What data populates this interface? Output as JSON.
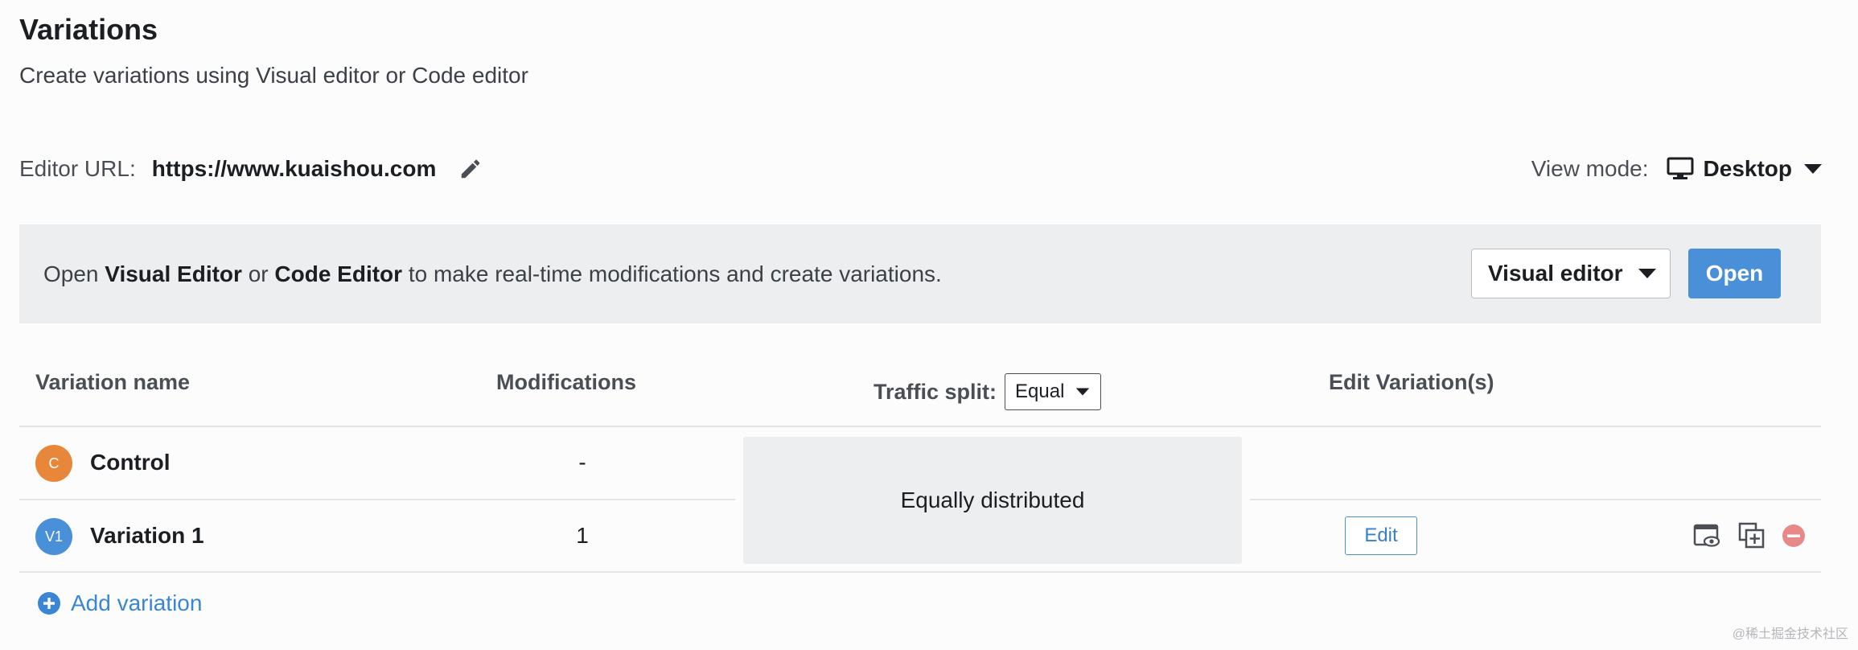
{
  "header": {
    "title": "Variations",
    "subtitle": "Create variations using Visual editor or Code editor"
  },
  "editor_url": {
    "label": "Editor URL:",
    "value": "https://www.kuaishou.com",
    "edit_icon": "pencil-icon"
  },
  "view_mode": {
    "label": "View mode:",
    "value": "Desktop",
    "icon": "monitor-icon"
  },
  "banner": {
    "text_prefix": "Open ",
    "visual_editor": "Visual Editor",
    "text_middle": " or ",
    "code_editor": "Code Editor",
    "text_suffix": " to make real-time modifications and create variations.",
    "editor_select": "Visual editor",
    "open_button": "Open"
  },
  "table": {
    "columns": {
      "name": "Variation name",
      "modifications": "Modifications",
      "traffic_split": "Traffic split:",
      "edit": "Edit Variation(s)"
    },
    "traffic_split_value": "Equal",
    "distribution_text": "Equally distributed",
    "rows": [
      {
        "badge": "C",
        "badge_color": "#e8873a",
        "name": "Control",
        "modifications": "-"
      },
      {
        "badge": "V1",
        "badge_color": "#4a90d9",
        "name": "Variation 1",
        "modifications": "1",
        "edit_label": "Edit"
      }
    ],
    "add_variation": "Add variation"
  },
  "colors": {
    "accent": "#4a90d9",
    "banner_bg": "#eceef0",
    "remove": "#e36a6a"
  },
  "watermark": "@稀土掘金技术社区"
}
